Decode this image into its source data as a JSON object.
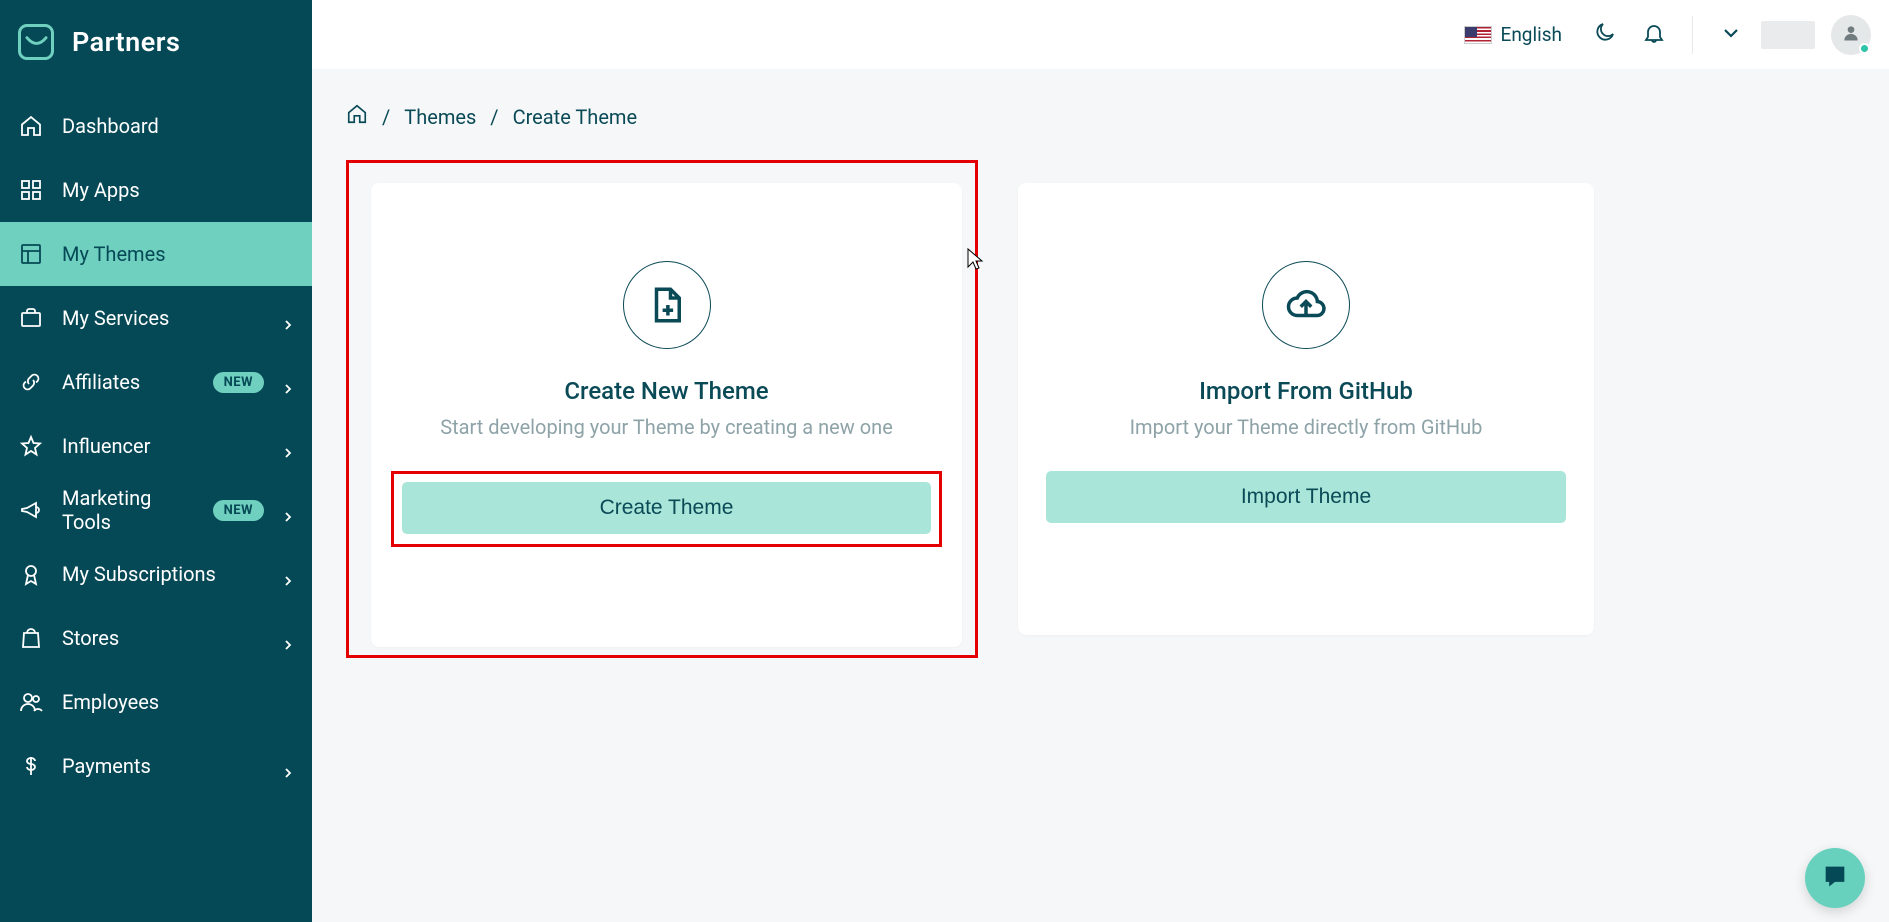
{
  "brand": {
    "title": "Partners"
  },
  "sidebar": {
    "items": [
      {
        "label": "Dashboard"
      },
      {
        "label": "My Apps"
      },
      {
        "label": "My Themes"
      },
      {
        "label": "My Services"
      },
      {
        "label": "Affiliates",
        "badge": "NEW"
      },
      {
        "label": "Influencer"
      },
      {
        "label": "Marketing Tools",
        "badge": "NEW"
      },
      {
        "label": "My Subscriptions"
      },
      {
        "label": "Stores"
      },
      {
        "label": "Employees"
      },
      {
        "label": "Payments"
      }
    ]
  },
  "topbar": {
    "language": "English"
  },
  "breadcrumbs": {
    "sep": "/",
    "items": [
      {
        "label": "Themes"
      },
      {
        "label": "Create Theme"
      }
    ]
  },
  "cards": {
    "create": {
      "title": "Create New Theme",
      "subtitle": "Start developing your Theme by creating a new one",
      "button": "Create Theme"
    },
    "import": {
      "title": "Import From GitHub",
      "subtitle": "Import your Theme directly from GitHub",
      "button": "Import Theme"
    }
  }
}
